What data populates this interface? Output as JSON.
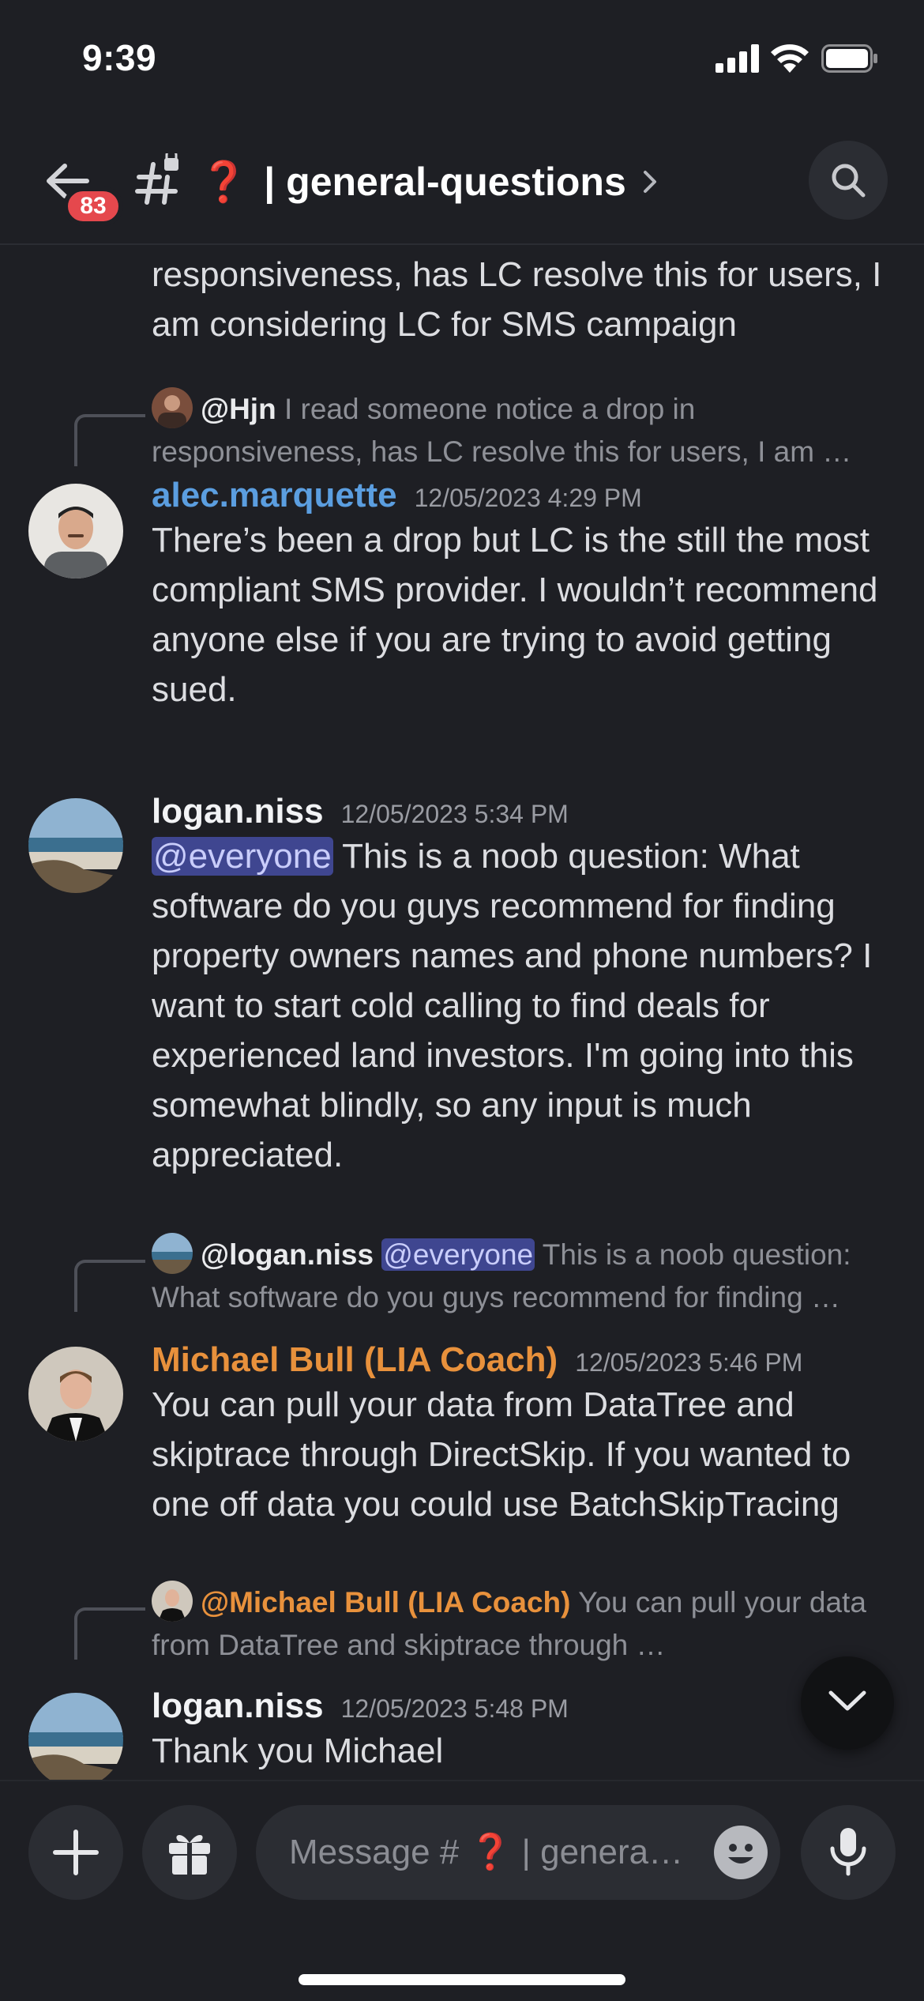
{
  "status_bar": {
    "time": "9:39"
  },
  "header": {
    "unread_count": "83",
    "channel_emoji": "❓",
    "channel_name": "| general-questions"
  },
  "messages": {
    "top_fragment": "responsiveness, has LC resolve this for users, I am considering LC for SMS campaign",
    "m1": {
      "reply_user": "@Hjn",
      "reply_text": "I read someone notice a drop in responsiveness, has LC resolve this for users, I am …",
      "username": "alec.marquette",
      "timestamp": "12/05/2023 4:29 PM",
      "text": "There’s been a drop but LC is the still the most compliant SMS provider. I wouldn’t recommend anyone else if you are trying to avoid getting sued."
    },
    "m2": {
      "username": "logan.niss",
      "timestamp": "12/05/2023 5:34 PM",
      "mention": "@everyone",
      "text": "This is a noob question: What software do you guys recommend for finding property owners names and phone numbers? I want to start cold calling to find deals for experienced land investors. I'm going into this somewhat blindly, so any input is much appreciated."
    },
    "m3": {
      "reply_user": "@logan.niss",
      "reply_mention": "@everyone",
      "reply_text": "This is a noob question: What software do you guys recommend for finding …",
      "username": "Michael Bull (LIA Coach)",
      "timestamp": "12/05/2023 5:46 PM",
      "text": "You can pull your data from DataTree and skiptrace through DirectSkip. If you wanted to one off data you could use BatchSkipTracing"
    },
    "m4": {
      "reply_user": "@Michael Bull (LIA Coach)",
      "reply_text": "You can pull your data from DataTree and skiptrace through …",
      "username": "logan.niss",
      "timestamp": "12/05/2023 5:48 PM",
      "text": "Thank you Michael"
    }
  },
  "composer": {
    "placeholder": "Message # ❓ | general..."
  },
  "colors": {
    "background": "#1e1f24",
    "alec_name": "#5b9ee0",
    "coach_name": "#e8913c",
    "mention_bg": "#3f4690",
    "badge": "#e5484d"
  }
}
